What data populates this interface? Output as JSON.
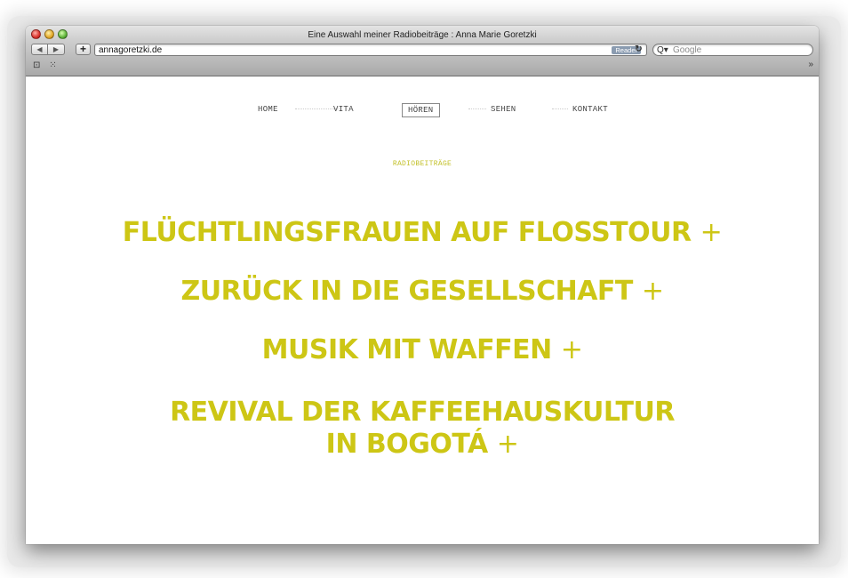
{
  "browser": {
    "title": "Eine Auswahl meiner Radiobeiträge : Anna Marie Goretzki",
    "url": "annagoretzki.de",
    "reader_label": "Reader",
    "search_placeholder": "Google",
    "icons": {
      "back": "◀",
      "forward": "▶",
      "add": "+",
      "reload": "↻",
      "search": "Q▾",
      "bookmarks_book": "⊡",
      "top_sites": "⁙",
      "overflow": "»"
    }
  },
  "site": {
    "nav": [
      {
        "label": "HOME"
      },
      {
        "label": "VITA"
      },
      {
        "label": "HÖREN"
      },
      {
        "label": "SEHEN"
      },
      {
        "label": "KONTAKT"
      }
    ],
    "section_label": "RADIOBEITRÄGE",
    "accent_color": "#cdc615",
    "items": [
      {
        "line1": "FLÜCHTLINGSFRAUEN AUF FLOSSTOUR",
        "line2": "",
        "plus": "+"
      },
      {
        "line1": "ZURÜCK IN DIE GESELLSCHAFT",
        "line2": "",
        "plus": "+"
      },
      {
        "line1": "MUSIK MIT WAFFEN",
        "line2": "",
        "plus": "+"
      },
      {
        "line1": "REVIVAL DER KAFFEEHAUSKULTUR",
        "line2": "IN BOGOTÁ",
        "plus": "+"
      }
    ]
  }
}
